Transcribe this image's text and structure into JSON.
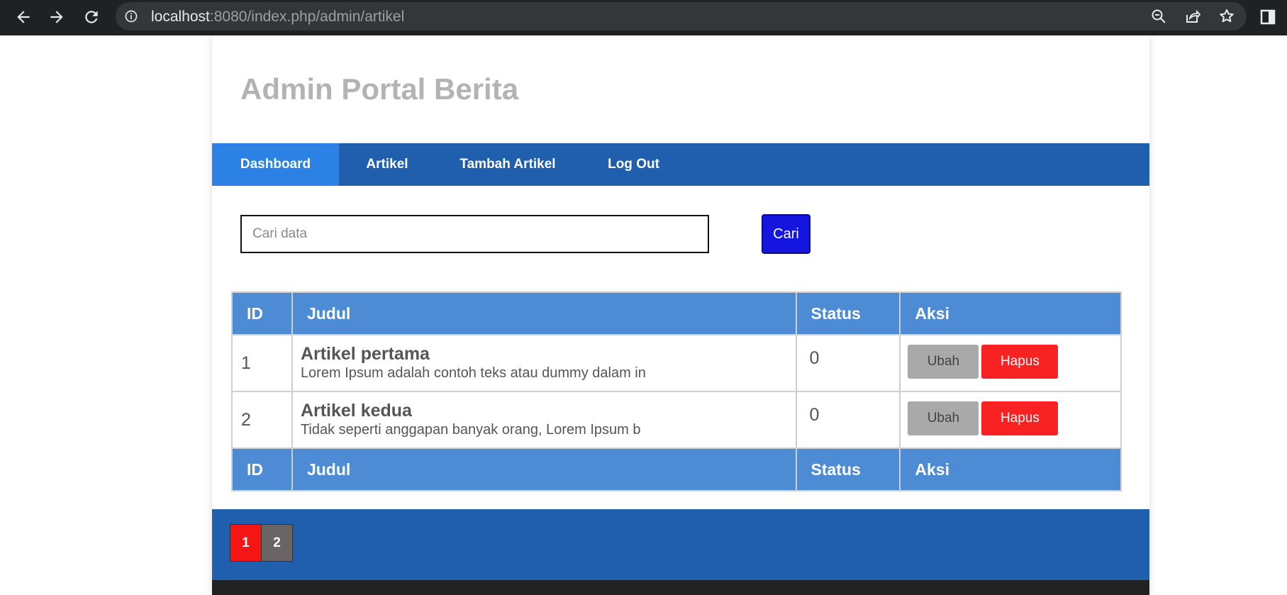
{
  "browser": {
    "url_host": "localhost",
    "url_rest": ":8080/index.php/admin/artikel"
  },
  "header": {
    "title": "Admin Portal Berita"
  },
  "nav": {
    "items": [
      {
        "label": "Dashboard"
      },
      {
        "label": "Artikel"
      },
      {
        "label": "Tambah Artikel"
      },
      {
        "label": "Log Out"
      }
    ]
  },
  "search": {
    "placeholder": "Cari data",
    "value": "",
    "button_label": "Cari"
  },
  "table": {
    "columns": [
      "ID",
      "Judul",
      "Status",
      "Aksi"
    ],
    "rows": [
      {
        "id": "1",
        "title": "Artikel pertama",
        "excerpt": "Lorem Ipsum adalah contoh teks atau dummy dalam in",
        "status": "0",
        "edit_label": "Ubah",
        "delete_label": "Hapus"
      },
      {
        "id": "2",
        "title": "Artikel kedua",
        "excerpt": "Tidak seperti anggapan banyak orang, Lorem Ipsum b",
        "status": "0",
        "edit_label": "Ubah",
        "delete_label": "Hapus"
      }
    ]
  },
  "pagination": {
    "pages": [
      "1",
      "2"
    ],
    "current": "1"
  },
  "colors": {
    "nav_bg": "#1f5fad",
    "nav_active": "#2b82e4",
    "table_header": "#4d8bd4",
    "search_button": "#1515e0",
    "delete_button": "#f92222",
    "edit_button": "#a9a9a9",
    "page_current": "#f41515"
  }
}
